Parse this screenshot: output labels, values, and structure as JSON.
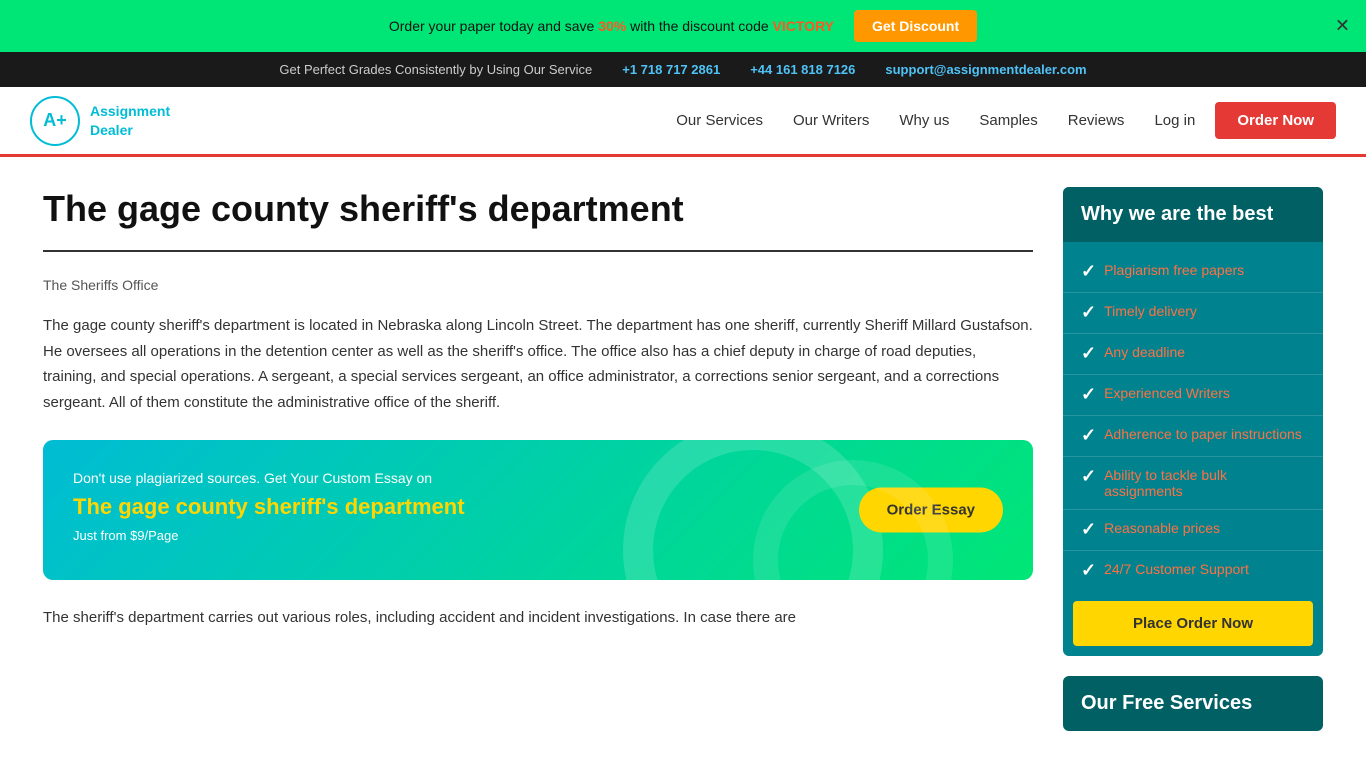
{
  "top_banner": {
    "text_before_pct": "Order your paper today and save ",
    "discount_pct": "30%",
    "text_after_pct": " with the discount code ",
    "discount_code": "VICTORY",
    "button_label": "Get Discount",
    "close_label": "✕"
  },
  "contact_bar": {
    "text": "Get Perfect Grades Consistently by Using Our Service",
    "phone1": "+1 718 717 2861",
    "phone2": "+44 161 818 7126",
    "email": "support@assignmentdealer.com"
  },
  "nav": {
    "logo_icon": "A+",
    "logo_line1": "Assignment",
    "logo_line2": "Dealer",
    "links": [
      {
        "label": "Our Services",
        "href": "#"
      },
      {
        "label": "Our Writers",
        "href": "#"
      },
      {
        "label": "Why us",
        "href": "#"
      },
      {
        "label": "Samples",
        "href": "#"
      },
      {
        "label": "Reviews",
        "href": "#"
      },
      {
        "label": "Log in",
        "href": "#"
      }
    ],
    "order_button": "Order Now"
  },
  "article": {
    "title": "The gage county sheriff's department",
    "subtitle": "The Sheriffs Office",
    "body1": "The gage county sheriff's department is located in Nebraska along Lincoln Street. The department has one sheriff, currently Sheriff Millard Gustafson. He oversees all operations in the detention center as well as the sheriff's office. The office also has a chief deputy in charge of road deputies, training, and special operations. A sergeant, a special services sergeant, an office administrator, a corrections senior sergeant, and a corrections sergeant. All of them constitute the administrative office of the sheriff.",
    "essay_box": {
      "intro": "Don't use plagiarized sources. Get Your Custom Essay on",
      "title": "The gage county sheriff's department",
      "price": "Just from $9/Page",
      "button": "Order Essay"
    },
    "body2": "The sheriff's department carries out various roles, including accident and incident investigations. In case there are"
  },
  "sidebar": {
    "why_header": "Why we are the best",
    "items": [
      {
        "label": "Plagiarism free papers"
      },
      {
        "label": "Timely delivery"
      },
      {
        "label": "Any deadline"
      },
      {
        "label": "Experienced Writers"
      },
      {
        "label": "Adherence to paper instructions"
      },
      {
        "label": "Ability to tackle bulk assignments"
      },
      {
        "label": "Reasonable prices"
      },
      {
        "label": "24/7 Customer Support"
      }
    ],
    "place_order": "Place Order Now",
    "free_services_header": "Our Free Services"
  }
}
